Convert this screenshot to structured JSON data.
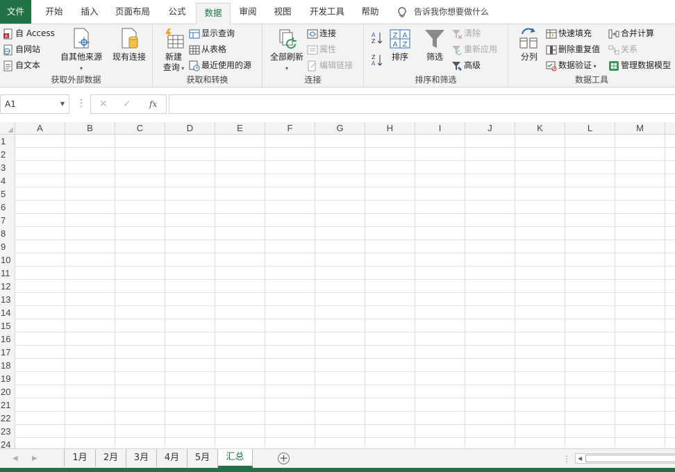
{
  "tabs": [
    {
      "label": "文件"
    },
    {
      "label": "开始"
    },
    {
      "label": "插入"
    },
    {
      "label": "页面布局"
    },
    {
      "label": "公式"
    },
    {
      "label": "数据"
    },
    {
      "label": "审阅"
    },
    {
      "label": "视图"
    },
    {
      "label": "开发工具"
    },
    {
      "label": "帮助"
    }
  ],
  "active_tab": "数据",
  "tell_me": "告诉我你想要做什么",
  "ribbon": {
    "external": {
      "label": "获取外部数据",
      "access": "自 Access",
      "web": "自网站",
      "text": "自文本",
      "other": "自其他来源",
      "existing": "现有连接"
    },
    "transform": {
      "label": "获取和转换",
      "new_query_1": "新建",
      "new_query_2": "查询",
      "show_queries": "显示查询",
      "from_table": "从表格",
      "recent": "最近使用的源"
    },
    "connections": {
      "label": "连接",
      "refresh_all": "全部刷新",
      "connections": "连接",
      "properties": "属性",
      "edit_links": "编辑链接"
    },
    "sort_filter": {
      "label": "排序和筛选",
      "sort": "排序",
      "filter": "筛选",
      "clear": "清除",
      "reapply": "重新应用",
      "advanced": "高级"
    },
    "data_tools": {
      "label": "数据工具",
      "split": "分列",
      "flash_fill": "快速填充",
      "remove_dup": "删除重复值",
      "validation": "数据验证",
      "consolidate": "合并计算",
      "relationships": "关系",
      "data_model": "管理数据模型"
    }
  },
  "formula_bar": {
    "name_box": "A1",
    "fx": "fx",
    "formula": ""
  },
  "columns": [
    "A",
    "B",
    "C",
    "D",
    "E",
    "F",
    "G",
    "H",
    "I",
    "J",
    "K",
    "L",
    "M"
  ],
  "rows": [
    "1",
    "2",
    "3",
    "4",
    "5",
    "6",
    "7",
    "8",
    "9",
    "10",
    "11",
    "12",
    "13",
    "14",
    "15",
    "16",
    "17",
    "18",
    "19",
    "20",
    "21",
    "22",
    "23",
    "24"
  ],
  "sheets": [
    "1月",
    "2月",
    "3月",
    "4月",
    "5月",
    "汇总"
  ],
  "active_sheet": "汇总",
  "colors": {
    "accent": "#217346",
    "ribbon_bg": "#f3f3f3",
    "grid": "#e1e1e1"
  }
}
